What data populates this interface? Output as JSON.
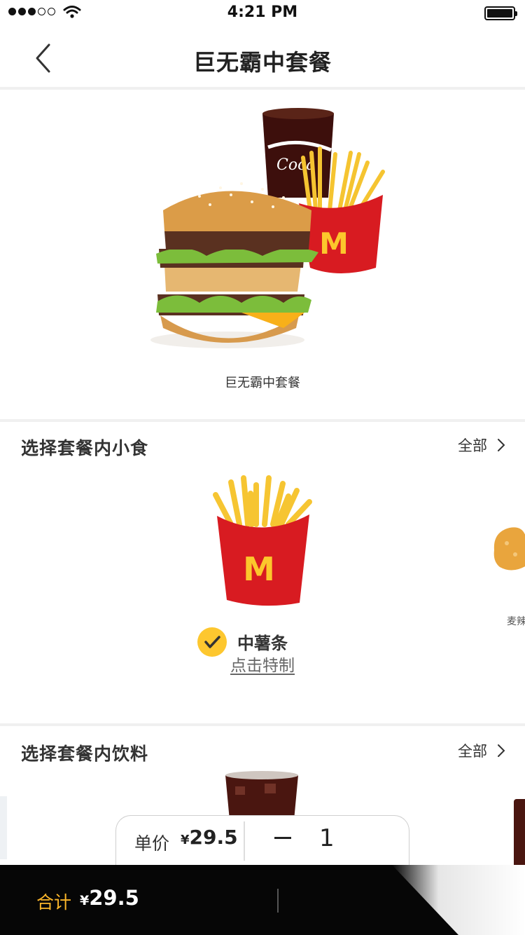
{
  "status_bar": {
    "time": "4:21 PM"
  },
  "nav": {
    "title": "巨无霸中套餐"
  },
  "hero": {
    "caption": "巨无霸中套餐"
  },
  "sides": {
    "title": "选择套餐内小食",
    "all_label": "全部",
    "selected_item": "中薯条",
    "customize_label": "点击特制",
    "edge_item_label": "麦辣"
  },
  "drinks": {
    "title": "选择套餐内饮料",
    "all_label": "全部"
  },
  "quantity_panel": {
    "unit_label": "单价",
    "currency": "¥",
    "unit_price": "29.5",
    "quantity": "1"
  },
  "bottom_bar": {
    "total_label": "合计",
    "currency": "¥",
    "total": "29.5"
  },
  "colors": {
    "accent_yellow": "#fdc72f",
    "total_label": "#fbb62a",
    "mcd_red": "#d81b21"
  }
}
